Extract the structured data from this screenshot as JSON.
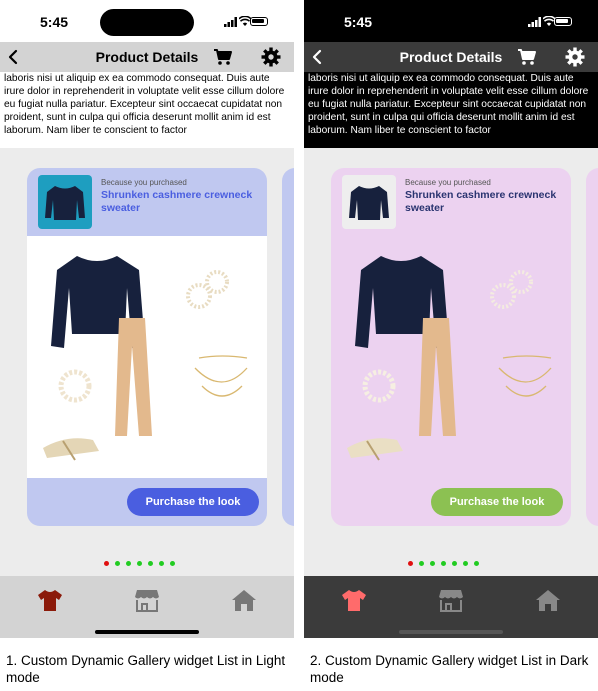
{
  "status_bar": {
    "time": "5:45"
  },
  "header": {
    "title": "Product Details"
  },
  "lorem_text": "laboris nisi ut aliquip ex ea commodo consequat. Duis aute irure dolor in reprehenderit in voluptate velit esse cillum dolore eu fugiat nulla pariatur. Excepteur sint occaecat cupidatat non proident, sunt in culpa qui officia deserunt mollit anim id est laborum. Nam liber te conscient to factor",
  "card": {
    "because_label": "Because you purchased",
    "product_name": "Shrunken cashmere crewneck sweater",
    "button_label": "Purchase the look"
  },
  "pager": {
    "count": 7,
    "active_index": 0,
    "active_color": "#e01010",
    "inactive_color": "#22cc22"
  },
  "colors": {
    "light_card": "#c0c8f0",
    "light_button": "#4a5ee0",
    "dark_card": "#ecd2f0",
    "dark_button": "#8cc152",
    "light_active_tab": "#8b1a0a",
    "dark_active_tab": "#ff6b6b",
    "inactive_tab": "#777777"
  },
  "tabs": [
    {
      "icon": "tshirt-icon",
      "active": true
    },
    {
      "icon": "store-icon",
      "active": false
    },
    {
      "icon": "home-icon",
      "active": false
    }
  ],
  "captions": {
    "light": "1. Custom Dynamic Gallery widget List in Light mode",
    "dark": "2. Custom Dynamic Gallery widget List in Dark mode"
  }
}
